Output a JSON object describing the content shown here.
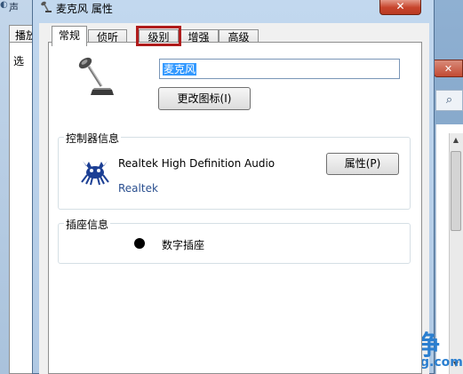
{
  "bg_window": {
    "title_fragment": "声",
    "tab_fragment": "播放",
    "panel_text_fragment": "选"
  },
  "dialog": {
    "title": "麦克风 属性",
    "close_symbol": "✕"
  },
  "tabs": [
    {
      "label": "常规",
      "active": true
    },
    {
      "label": "侦听",
      "active": false
    },
    {
      "label": "级别",
      "active": false,
      "highlighted": true
    },
    {
      "label": "增强",
      "active": false
    },
    {
      "label": "高级",
      "active": false
    }
  ],
  "general": {
    "device_name": "麦克风",
    "change_icon_button": "更改图标(I)",
    "controller_group_label": "控制器信息",
    "controller_name": "Realtek High Definition Audio",
    "controller_vendor": "Realtek",
    "properties_button": "属性(P)",
    "jack_group_label": "插座信息",
    "jack_label": "数字插座"
  },
  "bg_right": {
    "close_symbol": "✕",
    "search_symbol": "⌕",
    "scroll_up": "▲",
    "scroll_down": "▼"
  },
  "watermark": {
    "cn": "爱纯净",
    "en": "aichunjing.com",
    "color": "#2b7fd0"
  },
  "colors": {
    "tab_highlight": "#b01c1c",
    "selection": "#3399ff",
    "vendor_link": "#2a4f8f"
  },
  "icons": {
    "title": "microphone-icon",
    "device": "microphone-icon",
    "controller": "realtek-crab-icon"
  }
}
